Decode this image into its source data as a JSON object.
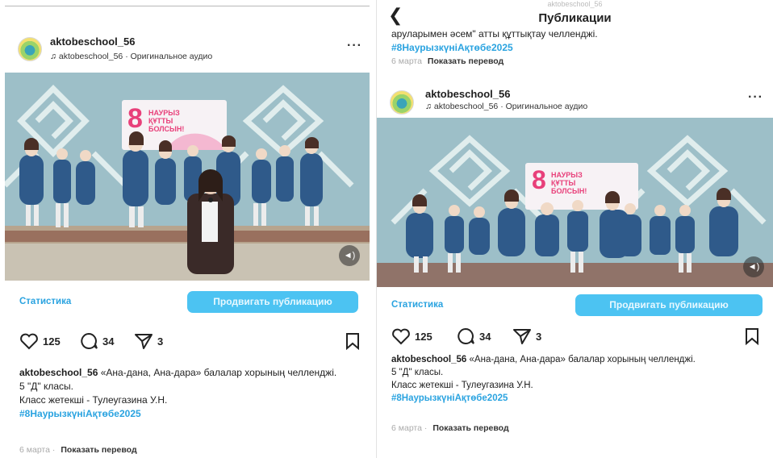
{
  "left_post": {
    "username": "aktobeschool_56",
    "audio": "aktobeschool_56 · Оригинальное аудио",
    "more": "···",
    "banner": [
      "8",
      "НАУРЫЗ",
      "ҚҰТТЫ",
      "БОЛСЫН!"
    ],
    "statistics_label": "Статистика",
    "promote_label": "Продвигать публикацию",
    "likes": "125",
    "comments": "34",
    "shares": "3",
    "caption_user": "aktobeschool_56",
    "caption_text": "«Ана-дана, Ана-дара» балалар хорының челленджі.",
    "caption_line2": "5 \"Д\" класы.",
    "caption_line3": "Класс жетекші - Тулеугазина У.Н.",
    "hashtag": "#8НаурызкүніАқтөбе2025",
    "date": "6 марта",
    "dot": "·",
    "translate": "Показать перевод"
  },
  "right_page": {
    "title": "Публикации",
    "ghost_title": "aktobeschool_56",
    "prev_caption": "аруларымен әсем\" атты құттықтау челленджі.",
    "prev_hashtag": "#8НаурызкүніАқтөбе2025",
    "prev_date": "6 марта",
    "prev_translate": "Показать перевод"
  },
  "right_post": {
    "username": "aktobeschool_56",
    "audio": "aktobeschool_56 · Оригинальное аудио",
    "more": "···",
    "banner": [
      "8",
      "НАУРЫЗ",
      "ҚҰТТЫ",
      "БОЛСЫН!"
    ],
    "statistics_label": "Статистика",
    "promote_label": "Продвигать публикацию",
    "likes": "125",
    "comments": "34",
    "shares": "3",
    "caption_user": "aktobeschool_56",
    "caption_text": "«Ана-дана, Ана-дара» балалар хорының челленджі.",
    "caption_line2": "5 \"Д\" класы.",
    "caption_line3": "Класс жетекші - Тулеугазина У.Н.",
    "hashtag": "#8НаурызкүніАқтөбе2025",
    "date": "6 марта",
    "dot": "·",
    "translate": "Показать перевод"
  },
  "colors": {
    "link_blue": "#2aa3e0",
    "promote_bg": "#4cc3f2",
    "wall_blue": "#8fb3bd",
    "uniform_blue": "#2f5a8a",
    "banner_pink": "#e8407a"
  },
  "icons": [
    "music-note-icon",
    "more-icon",
    "sound-icon",
    "heart-icon",
    "comment-icon",
    "share-icon",
    "bookmark-icon",
    "back-arrow-icon"
  ]
}
